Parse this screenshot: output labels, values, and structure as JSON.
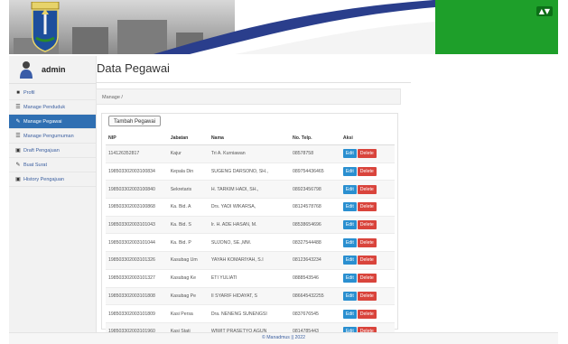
{
  "header": {
    "badge": "▲▼",
    "colors": {
      "accent": "#1e9f2a",
      "banner_swoosh": "#2a3e8c"
    }
  },
  "sidebar": {
    "user_name": "admin",
    "items": [
      {
        "label": "Profil",
        "icon": "user-icon",
        "active": false
      },
      {
        "label": "Manage Penduduk",
        "icon": "list-icon",
        "active": false
      },
      {
        "label": "Manage Pegawai",
        "icon": "pencil-icon",
        "active": true
      },
      {
        "label": "Manage Pengumuman",
        "icon": "list-icon",
        "active": false
      },
      {
        "label": "Draft Pengajuan",
        "icon": "document-icon",
        "active": false
      },
      {
        "label": "Buat Surat",
        "icon": "pencil-icon",
        "active": false
      },
      {
        "label": "History Pengajuan",
        "icon": "document-icon",
        "active": false
      }
    ]
  },
  "main": {
    "title": "Data Pegawai",
    "breadcrumb": "Manage /",
    "add_button": "Tambah Pegawai",
    "columns": [
      "NIP",
      "Jabatan",
      "Nama",
      "No. Telp.",
      "Aksi"
    ],
    "edit_label": "Edit",
    "delete_label": "Delete",
    "rows": [
      {
        "nip": "114126352817",
        "jabatan": "Kajur",
        "nama": "Tri A. Kurniawan",
        "telp": "08578758"
      },
      {
        "nip": "198503302003100834",
        "jabatan": "Kepala Din",
        "nama": "SUGENG DARSONO, SH.,",
        "telp": "089754436465"
      },
      {
        "nip": "198503302003100840",
        "jabatan": "Sekretaris",
        "nama": "H. TARKIM HADI, SH.,",
        "telp": "08923456798"
      },
      {
        "nip": "198503302003100868",
        "jabatan": "Ka. Bid. A",
        "nama": "Drs. YADI WIKARSA,",
        "telp": "08124578768"
      },
      {
        "nip": "198503302003101043",
        "jabatan": "Ka. Bid. S",
        "nama": "Ir. H. ADE HASAN, M.",
        "telp": "08538654696"
      },
      {
        "nip": "198503302003101044",
        "jabatan": "Ka. Bid. P",
        "nama": "SUJONO, SE.,MM.",
        "telp": "08327544488"
      },
      {
        "nip": "198503302003101326",
        "jabatan": "Kasubag Um",
        "nama": "YAYAH KOMARIYAH, S.I",
        "telp": "08123643234"
      },
      {
        "nip": "198503302003101327",
        "jabatan": "Kasubag Ke",
        "nama": "ETI YULIATI",
        "telp": "0888543546"
      },
      {
        "nip": "198503302003101808",
        "jabatan": "Kasubag Pe",
        "nama": "II SYARIF HIDAYAT, S",
        "telp": "086645432255"
      },
      {
        "nip": "198503302003101809",
        "jabatan": "Kasi Persa",
        "nama": "Dra. NENENG SUNENGSI",
        "telp": "0837676545"
      },
      {
        "nip": "198503302003101960",
        "jabatan": "Kasi Stati",
        "nama": "WIWIT PRASETYO AGUN",
        "telp": "0814785443"
      }
    ]
  },
  "footer": {
    "text": "© Manadmus  ||  2022"
  }
}
